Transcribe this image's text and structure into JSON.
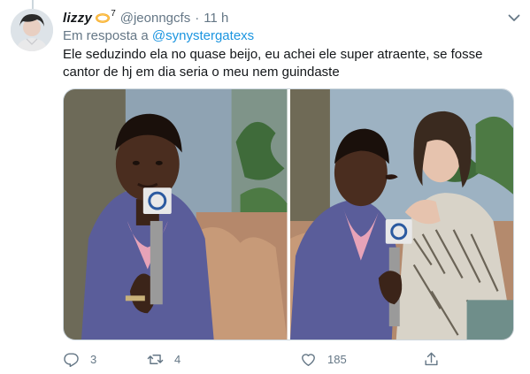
{
  "tweet": {
    "display_name": "lizzy",
    "name_emoji": "hoop-earring-emoji",
    "name_superscript": "7",
    "handle": "@jeonngcfs",
    "separator": "·",
    "time": "11 h",
    "reply_prefix": "Em resposta a",
    "reply_mention": "@synystergatexs",
    "text": "Ele seduzindo ela no quase beijo, eu achei ele super atraente, se fosse cantor de hj em dia seria o meu nem guindaste",
    "actions": {
      "reply_count": "3",
      "retweet_count": "4",
      "like_count": "185"
    }
  },
  "icons": {
    "caret": "chevron-down-icon",
    "reply": "reply-icon",
    "retweet": "retweet-icon",
    "like": "heart-icon",
    "share": "share-icon"
  },
  "colors": {
    "text_primary": "#14171a",
    "text_secondary": "#657786",
    "link": "#1b95e0",
    "border": "#ccd6dd"
  }
}
